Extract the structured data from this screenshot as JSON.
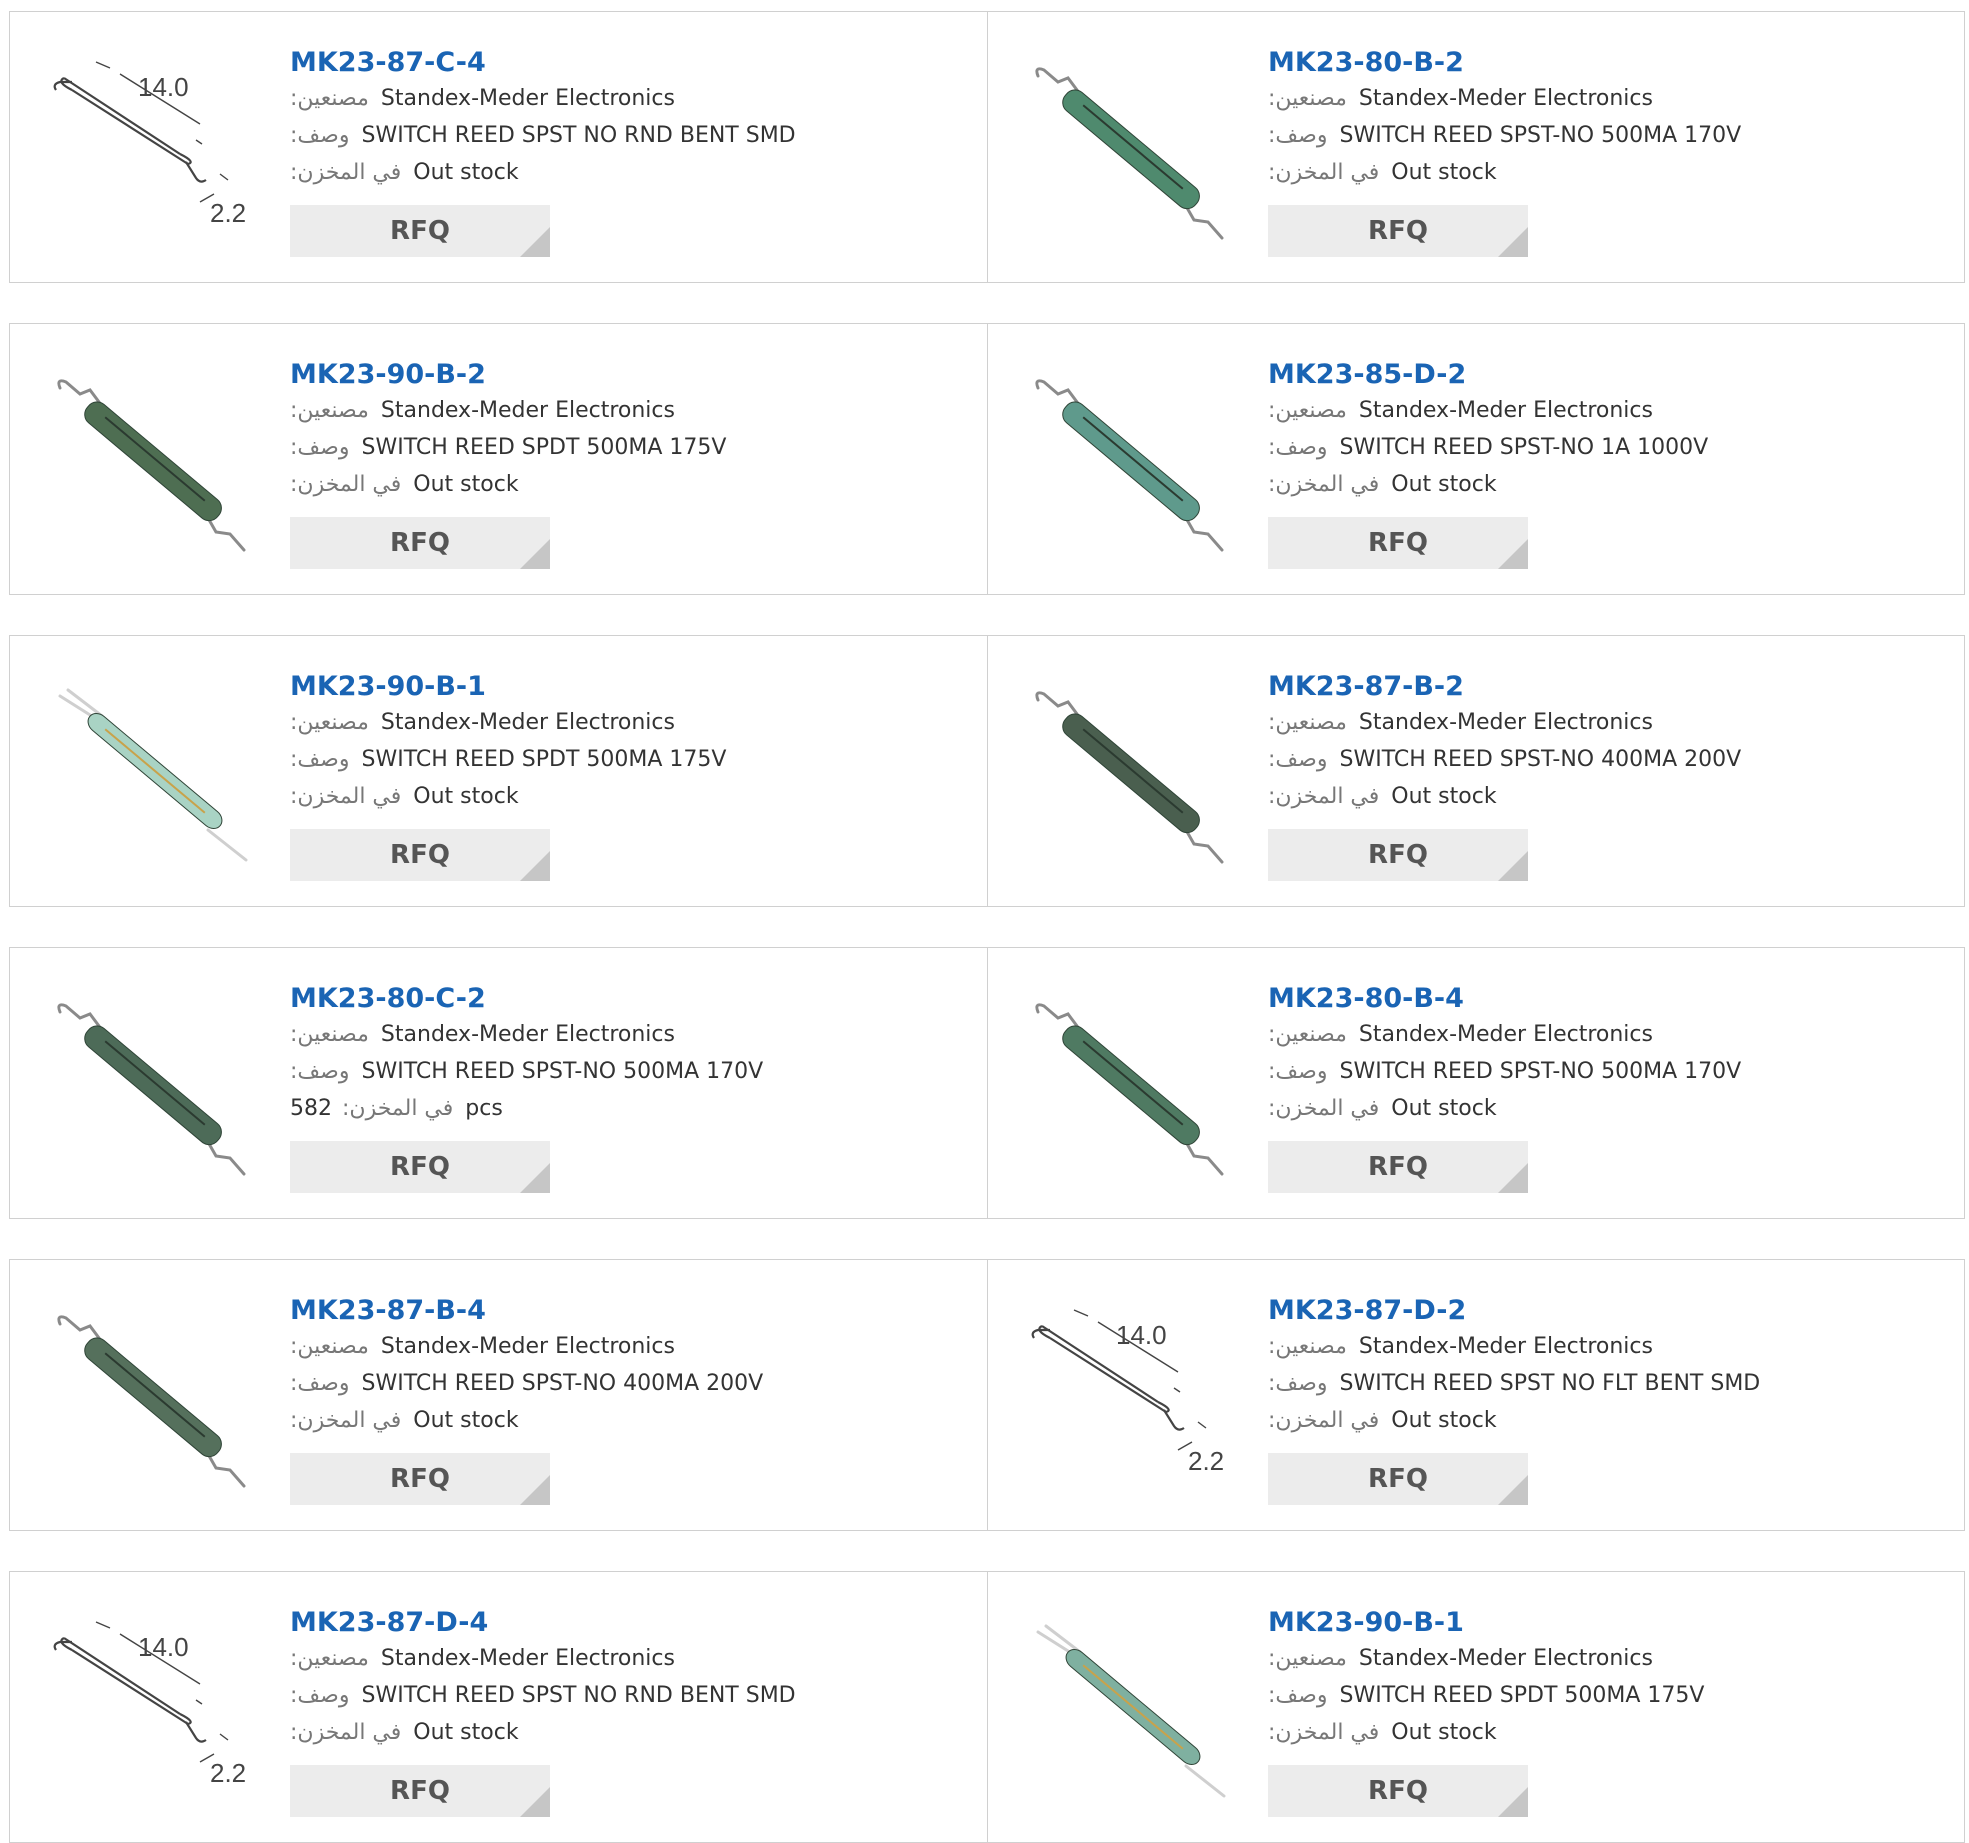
{
  "labels": {
    "manufacturer": "مصنعين:",
    "description": "وصف:",
    "stock": "في المخزن:",
    "rfq": "RFQ"
  },
  "rows": [
    [
      {
        "part": "MK23-87-C-4",
        "manufacturer": "Standex-Meder Electronics",
        "description": "SWITCH REED SPST NO RND BENT SMD",
        "stock": "Out stock",
        "image": "dimension-drawing",
        "dim_length": "14.0",
        "dim_height": "2.2"
      },
      {
        "part": "MK23-80-B-2",
        "manufacturer": "Standex-Meder Electronics",
        "description": "SWITCH REED SPST-NO 500MA 170V",
        "stock": "Out stock",
        "image": "reed-green-bent",
        "glass": "#4f8a6e"
      }
    ],
    [
      {
        "part": "MK23-90-B-2",
        "manufacturer": "Standex-Meder Electronics",
        "description": "SWITCH REED SPDT 500MA 175V",
        "stock": "Out stock",
        "image": "reed-green-bent",
        "glass": "#4e6e52"
      },
      {
        "part": "MK23-85-D-2",
        "manufacturer": "Standex-Meder Electronics",
        "description": "SWITCH REED SPST-NO 1A 1000V",
        "stock": "Out stock",
        "image": "reed-long",
        "glass": "#5f9a8c"
      }
    ],
    [
      {
        "part": "MK23-90-B-1",
        "manufacturer": "Standex-Meder Electronics",
        "description": "SWITCH REED SPDT 500MA 175V",
        "stock": "Out stock",
        "image": "reed-light-straight",
        "glass": "#a9d3c4"
      },
      {
        "part": "MK23-87-B-2",
        "manufacturer": "Standex-Meder Electronics",
        "description": "SWITCH REED SPST-NO 400MA 200V",
        "stock": "Out stock",
        "image": "reed-dark",
        "glass": "#4a5f4f"
      }
    ],
    [
      {
        "part": "MK23-80-C-2",
        "manufacturer": "Standex-Meder Electronics",
        "description": "SWITCH REED SPST-NO 500MA 170V",
        "stock_qty": "582",
        "stock_unit": "pcs",
        "image": "reed-dark",
        "glass": "#4d6b58"
      },
      {
        "part": "MK23-80-B-4",
        "manufacturer": "Standex-Meder Electronics",
        "description": "SWITCH REED SPST-NO 500MA 170V",
        "stock": "Out stock",
        "image": "reed-green-bent",
        "glass": "#4f7a62"
      }
    ],
    [
      {
        "part": "MK23-87-B-4",
        "manufacturer": "Standex-Meder Electronics",
        "description": "SWITCH REED SPST-NO 400MA 200V",
        "stock": "Out stock",
        "image": "reed-green-bent",
        "glass": "#55705c"
      },
      {
        "part": "MK23-87-D-2",
        "manufacturer": "Standex-Meder Electronics",
        "description": "SWITCH REED SPST NO FLT BENT SMD",
        "stock": "Out stock",
        "image": "dimension-drawing",
        "dim_length": "14.0",
        "dim_height": "2.2"
      }
    ],
    [
      {
        "part": "MK23-87-D-4",
        "manufacturer": "Standex-Meder Electronics",
        "description": "SWITCH REED SPST NO RND BENT SMD",
        "stock": "Out stock",
        "image": "dimension-drawing",
        "dim_length": "14.0",
        "dim_height": "2.2"
      },
      {
        "part": "MK23-90-B-1",
        "manufacturer": "Standex-Meder Electronics",
        "description": "SWITCH REED SPDT 500MA 175V",
        "stock": "Out stock",
        "image": "reed-light-straight",
        "glass": "#7fb0a0"
      }
    ]
  ]
}
